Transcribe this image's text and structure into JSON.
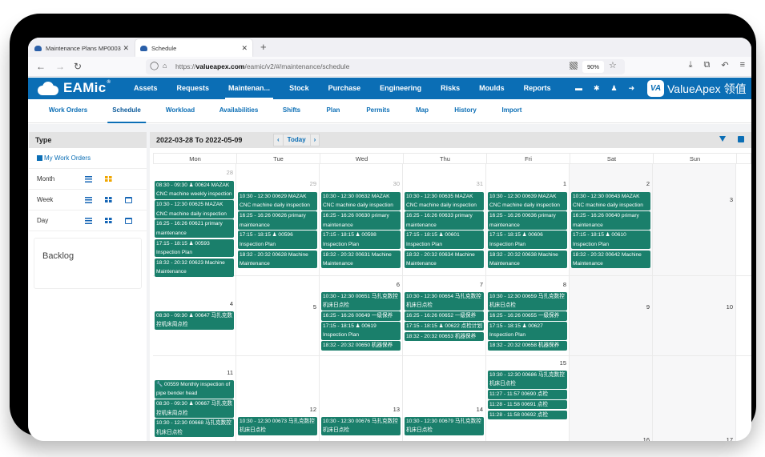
{
  "browser": {
    "tabs": [
      {
        "label": "Maintenance Plans MP0003",
        "active": false
      },
      {
        "label": "Schedule",
        "active": true
      }
    ],
    "new_tab": "+",
    "url_prefix": "https://",
    "url_domain": "valueapex.com",
    "url_path": "/eamic/v2/#/maintenance/schedule",
    "zoom": "90%",
    "icons": {
      "back": "←",
      "forward": "→",
      "reload": "↻",
      "shield": "◯",
      "lock": "🔒",
      "star": "☆",
      "download": "⤓",
      "crop": "⧉",
      "undo": "↶",
      "menu": "≡",
      "close": "✕"
    }
  },
  "app": {
    "logo": "EAMic",
    "logo_mark": "®",
    "nav": [
      "Assets",
      "Requests",
      "Maintenan...",
      "Stock",
      "Purchase",
      "Engineering",
      "Risks",
      "Moulds",
      "Reports"
    ],
    "nav_active": 2,
    "header_icons": [
      "▬",
      "✱",
      "♟",
      "➜"
    ],
    "brand_mark": "VA",
    "brand": "ValueApex 领值",
    "subnav": [
      "Work Orders",
      "Schedule",
      "Workload",
      "Availabilities",
      "Shifts",
      "Plan",
      "Permits",
      "Map",
      "History",
      "Import"
    ],
    "subnav_active": 1
  },
  "side": {
    "title": "Type",
    "my_work_orders": "My Work Orders",
    "views": [
      {
        "label": "Month"
      },
      {
        "label": "Week"
      },
      {
        "label": "Day"
      }
    ],
    "backlog": "Backlog"
  },
  "calendar": {
    "range": "2022-03-28 To 2022-05-09",
    "prev": "‹",
    "today": "Today",
    "next": "›",
    "days_of_week": [
      "Mon",
      "Tue",
      "Wed",
      "Thu",
      "Fri",
      "Sat",
      "Sun"
    ],
    "event_color": "#1a7f6b",
    "weeks": [
      {
        "days": [
          {
            "num": "28",
            "other": true,
            "events": [
              {
                "text": "08:30 - 09:30 ♟ 00624 MAZAK CNC machine weekly inspection"
              },
              {
                "text": "10:30 - 12:30 00625 MAZAK CNC machine daily inspection"
              },
              {
                "text": "16:25 - 16:26 00621 primary maintenance"
              },
              {
                "text": "17:15 - 18:15 ♟ 00593 Inspection Plan"
              },
              {
                "text": "18:32 - 20:32 00623 Machine Maintenance"
              }
            ]
          },
          {
            "num": "29",
            "other": true,
            "events": [
              {
                "text": "10:30 - 12:30 00629 MAZAK CNC machine daily inspection"
              },
              {
                "text": "16:25 - 16:26 00626 primary maintenance"
              },
              {
                "text": "17:15 - 18:15 ♟ 00596 Inspection Plan"
              },
              {
                "text": "18:32 - 20:32 00628 Machine Maintenance"
              }
            ]
          },
          {
            "num": "30",
            "other": true,
            "events": [
              {
                "text": "10:30 - 12:30 00632 MAZAK CNC machine daily inspection"
              },
              {
                "text": "16:25 - 16:26 00630 primary maintenance"
              },
              {
                "text": "17:15 - 18:15 ♟ 00598 Inspection Plan"
              },
              {
                "text": "18:32 - 20:32 00631 Machine Maintenance"
              }
            ]
          },
          {
            "num": "31",
            "other": true,
            "events": [
              {
                "text": "10:30 - 12:30 00635 MAZAK CNC machine daily inspection"
              },
              {
                "text": "16:25 - 16:26 00633 primary maintenance"
              },
              {
                "text": "17:15 - 18:15 ♟ 00601 Inspection Plan"
              },
              {
                "text": "18:32 - 20:32 00634 Machine Maintenance"
              }
            ]
          },
          {
            "num": "1",
            "other": false,
            "events": [
              {
                "text": "10:30 - 12:30 00639 MAZAK CNC machine daily inspection"
              },
              {
                "text": "16:25 - 16:26 00636 primary maintenance"
              },
              {
                "text": "17:15 - 18:15 ♟ 00606 Inspection Plan"
              },
              {
                "text": "18:32 - 20:32 00638 Machine Maintenance"
              }
            ]
          },
          {
            "num": "2",
            "other": false,
            "events": [
              {
                "text": "10:30 - 12:30 00643 MAZAK CNC machine daily inspection"
              },
              {
                "text": "16:25 - 16:26 00640 primary maintenance"
              },
              {
                "text": "17:15 - 18:15 ♟ 00610 Inspection Plan"
              },
              {
                "text": "18:32 - 20:32 00642 Machine Maintenance"
              }
            ]
          },
          {
            "num": "3",
            "other": false,
            "events": []
          }
        ]
      },
      {
        "days": [
          {
            "num": "4",
            "other": false,
            "events": [
              {
                "text": "08:30 - 09:30 ♟ 00647 马扎克数控机床周点检"
              }
            ]
          },
          {
            "num": "5",
            "other": false,
            "events": []
          },
          {
            "num": "6",
            "other": false,
            "events": [
              {
                "text": "10:30 - 12:30 00651 马扎克数控机床日点检"
              },
              {
                "text": "16:25 - 16:26 00649 一级保养"
              },
              {
                "text": "17:15 - 18:15 ♟ 00619 Inspection Plan"
              },
              {
                "text": "18:32 - 20:32 00650 机器保养"
              }
            ]
          },
          {
            "num": "7",
            "other": false,
            "events": [
              {
                "text": "10:30 - 12:30 00654 马扎克数控机床日点检"
              },
              {
                "text": "16:25 - 16:26 00652 一级保养"
              },
              {
                "text": "17:15 - 18:15 ♟ 00622 点检计划"
              },
              {
                "text": "18:32 - 20:32 00653 机器保养"
              }
            ]
          },
          {
            "num": "8",
            "other": false,
            "events": [
              {
                "text": "10:30 - 12:30 00659 马扎克数控机床日点检"
              },
              {
                "text": "16:25 - 16:26 00655 一级保养"
              },
              {
                "text": "17:15 - 18:15 ♟ 00627 Inspection Plan"
              },
              {
                "text": "18:32 - 20:32 00658 机器保养"
              }
            ]
          },
          {
            "num": "9",
            "other": false,
            "events": []
          },
          {
            "num": "10",
            "other": false,
            "events": []
          }
        ]
      },
      {
        "days": [
          {
            "num": "11",
            "other": false,
            "events": [
              {
                "text": "🔧 00559 Monthly inspection of pipe bender head"
              },
              {
                "text": "08:30 - 09:30 ♟ 00667 马扎克数控机床周点检"
              },
              {
                "text": "10:30 - 12:30 00668 马扎克数控机床日点检"
              }
            ]
          },
          {
            "num": "12",
            "other": false,
            "events": [
              {
                "text": "10:30 - 12:30 00673 马扎克数控机床日点检"
              }
            ]
          },
          {
            "num": "13",
            "other": false,
            "events": [
              {
                "text": "10:30 - 12:30 00676 马扎克数控机床日点检"
              }
            ]
          },
          {
            "num": "14",
            "other": false,
            "events": [
              {
                "text": "10:30 - 12:30 00679 马扎克数控机床日点检"
              }
            ]
          },
          {
            "num": "15",
            "other": false,
            "events": [
              {
                "text": "10:30 - 12:30 00686 马扎克数控机床日点检"
              },
              {
                "text": "11:27 - 11:57 00690 点检"
              },
              {
                "text": "11:28 - 11:58 00691 点检"
              },
              {
                "text": "11:28 - 11:58 00692 点检"
              }
            ]
          },
          {
            "num": "16",
            "other": false,
            "events": []
          },
          {
            "num": "17",
            "other": false,
            "events": []
          }
        ]
      }
    ]
  }
}
